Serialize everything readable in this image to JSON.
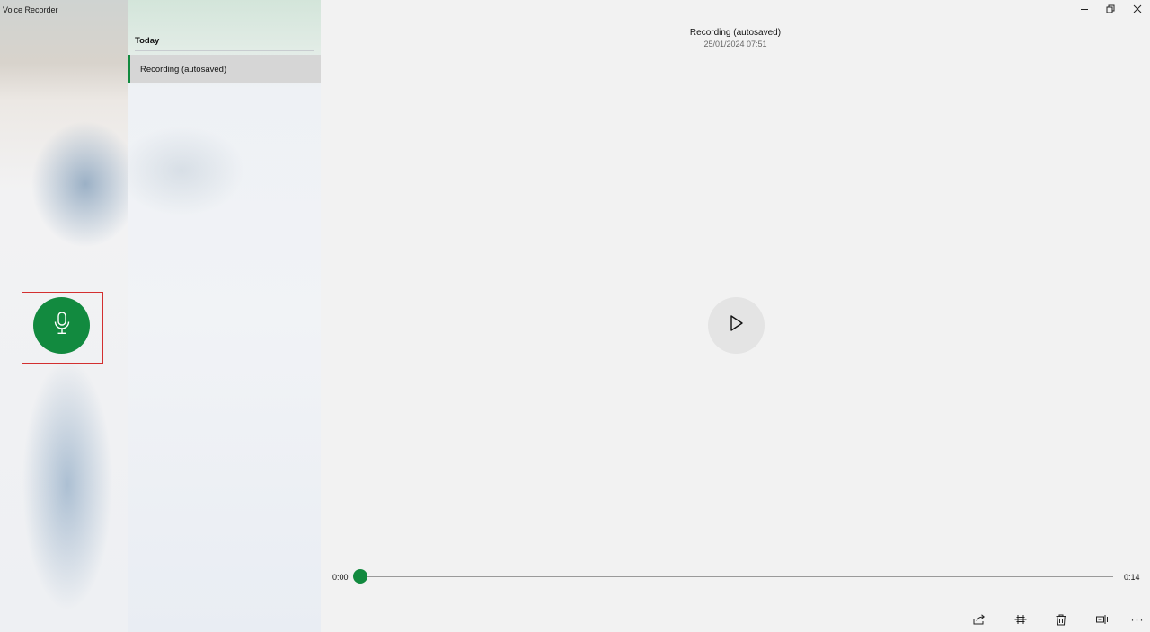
{
  "app": {
    "title": "Voice Recorder"
  },
  "colors": {
    "accent": "#128a3f",
    "selection": "#d6d6d6",
    "background": "#f2f2f2"
  },
  "recordings_list": {
    "group_header": "Today",
    "items": [
      {
        "label": "Recording (autosaved)",
        "selected": true
      }
    ]
  },
  "player": {
    "title": "Recording (autosaved)",
    "date": "25/01/2024 07:51",
    "position": "0:00",
    "duration": "0:14",
    "progress": 0.0
  },
  "toolbar": {
    "icons": [
      "share-icon",
      "trim-icon",
      "delete-icon",
      "markers-icon",
      "more-icon"
    ],
    "more_label": "···"
  },
  "window_controls": {
    "icons": [
      "minimize-icon",
      "restore-icon",
      "close-icon"
    ]
  },
  "record": {
    "icon": "microphone-icon"
  }
}
